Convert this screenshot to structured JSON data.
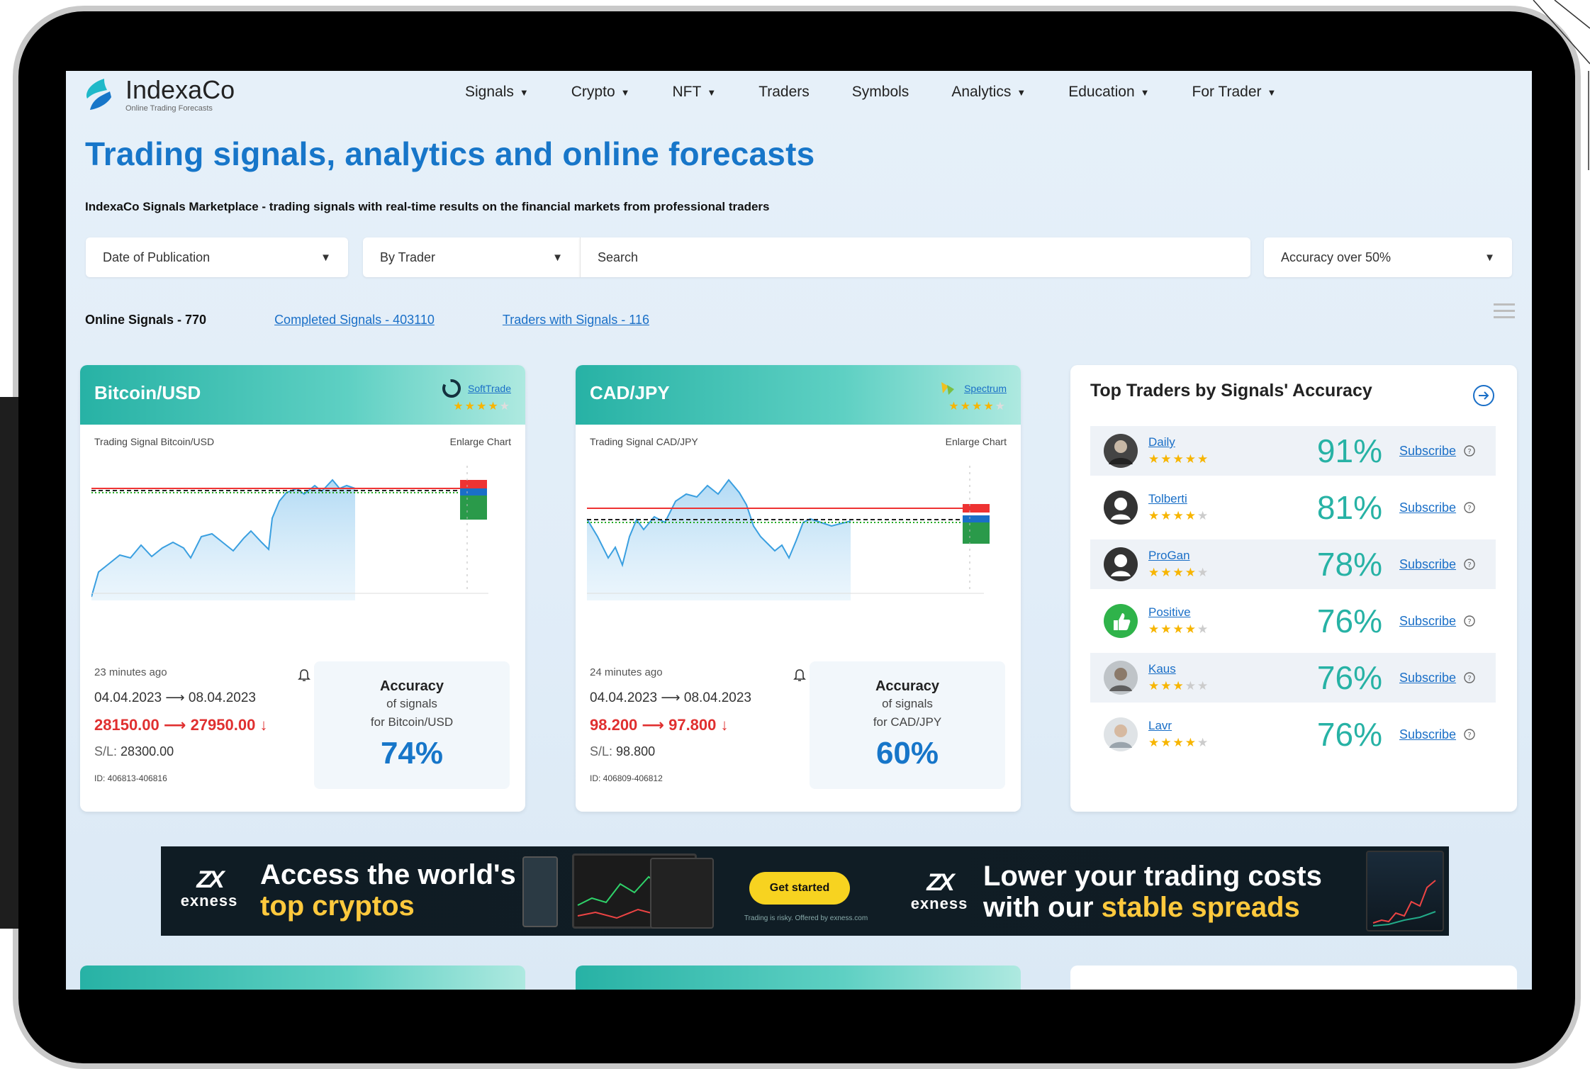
{
  "brand": {
    "name": "IndexaCo",
    "tagline": "Online Trading Forecasts",
    "logo_icon": "swoosh-logo-icon",
    "accent": "#1776c9",
    "teal": "#27b2a5"
  },
  "nav": [
    {
      "label": "Signals",
      "dropdown": true
    },
    {
      "label": "Crypto",
      "dropdown": true
    },
    {
      "label": "NFT",
      "dropdown": true
    },
    {
      "label": "Traders",
      "dropdown": false
    },
    {
      "label": "Symbols",
      "dropdown": false
    },
    {
      "label": "Analytics",
      "dropdown": true
    },
    {
      "label": "Education",
      "dropdown": true
    },
    {
      "label": "For Trader",
      "dropdown": true
    }
  ],
  "hero": {
    "title": "Trading signals, analytics and online forecasts",
    "subtitle": "IndexaCo Signals Marketplace - trading signals with real-time results on the financial markets from professional traders"
  },
  "filters": {
    "date": "Date of Publication",
    "trader": "By Trader",
    "search_placeholder": "Search",
    "accuracy": "Accuracy over 50%"
  },
  "counts": {
    "online": "Online Signals - 770",
    "completed": "Completed Signals - 403110",
    "traders": "Traders with Signals - 116"
  },
  "cards": [
    {
      "symbol": "Bitcoin/USD",
      "trader": "SoftTrade",
      "trader_rating": 4,
      "chart_label": "Trading Signal Bitcoin/USD",
      "enlarge": "Enlarge Chart",
      "ago": "23 minutes ago",
      "date_from": "04.04.2023",
      "date_to": "08.04.2023",
      "price_from": "28150.00",
      "price_to": "27950.00",
      "sl_label": "S/L:",
      "sl_value": "28300.00",
      "id": "ID: 406813-406816",
      "acc_title": "Accuracy",
      "acc_of": "of signals",
      "acc_for": "for Bitcoin/USD",
      "acc_value": "74%"
    },
    {
      "symbol": "CAD/JPY",
      "trader": "Spectrum",
      "trader_rating": 4,
      "chart_label": "Trading Signal CAD/JPY",
      "enlarge": "Enlarge Chart",
      "ago": "24 minutes ago",
      "date_from": "04.04.2023",
      "date_to": "08.04.2023",
      "price_from": "98.200",
      "price_to": "97.800",
      "sl_label": "S/L:",
      "sl_value": "98.800",
      "id": "ID: 406809-406812",
      "acc_title": "Accuracy",
      "acc_of": "of signals",
      "acc_for": "for CAD/JPY",
      "acc_value": "60%"
    }
  ],
  "top_traders": {
    "title": "Top Traders by Signals' Accuracy",
    "subscribe": "Subscribe",
    "rows": [
      {
        "name": "Daily",
        "stars": 5,
        "pct": "91%",
        "avatar": "photo"
      },
      {
        "name": "Tolberti",
        "stars": 4,
        "pct": "81%",
        "avatar": "default"
      },
      {
        "name": "ProGan",
        "stars": 4,
        "pct": "78%",
        "avatar": "default"
      },
      {
        "name": "Positive",
        "stars": 4,
        "pct": "76%",
        "avatar": "thumbs"
      },
      {
        "name": "Kaus",
        "stars": 3,
        "pct": "76%",
        "avatar": "photo"
      },
      {
        "name": "Lavr",
        "stars": 4,
        "pct": "76%",
        "avatar": "photo"
      }
    ]
  },
  "banner": {
    "brand": "exness",
    "left_line1": "Access the world's",
    "left_line2": "top cryptos",
    "button": "Get started",
    "disclaimer": "Trading is risky. Offered by exness.com",
    "right_line1": "Lower your trading costs",
    "right_line2_plain": "with our",
    "right_line2_hl": "stable spreads"
  }
}
